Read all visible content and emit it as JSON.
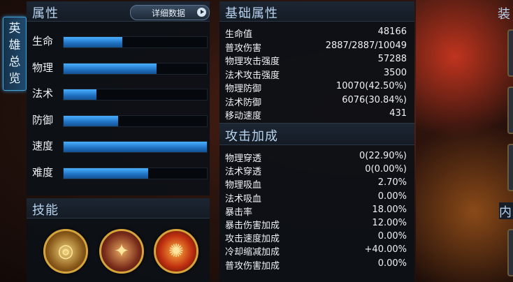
{
  "side_tab": {
    "label": "英雄总览"
  },
  "attributes": {
    "title": "属性",
    "detail_button": "详细数据",
    "bars": [
      {
        "label": "生命",
        "level": 0.41
      },
      {
        "label": "物理",
        "level": 0.65
      },
      {
        "label": "法术",
        "level": 0.23
      },
      {
        "label": "防御",
        "level": 0.38
      },
      {
        "label": "速度",
        "level": 1.0
      },
      {
        "label": "难度",
        "level": 0.59
      }
    ]
  },
  "skills": {
    "title": "技能",
    "icons": [
      "skill-1-icon",
      "skill-2-icon",
      "skill-3-icon"
    ]
  },
  "base_stats": {
    "title": "基础属性",
    "rows": [
      {
        "label": "生命值",
        "value": "48166"
      },
      {
        "label": "普攻伤害",
        "value": "2887/2887/10049"
      },
      {
        "label": "物理攻击强度",
        "value": "57288"
      },
      {
        "label": "法术攻击强度",
        "value": "3500"
      },
      {
        "label": "物理防御",
        "value": "10070(42.50%)"
      },
      {
        "label": "法术防御",
        "value": "6076(30.84%)"
      },
      {
        "label": "移动速度",
        "value": "431"
      }
    ]
  },
  "attack_bonus": {
    "title": "攻击加成",
    "rows": [
      {
        "label": "物理穿透",
        "value": "0(22.90%)"
      },
      {
        "label": "法术穿透",
        "value": "0(0.00%)"
      },
      {
        "label": "物理吸血",
        "value": "2.70%"
      },
      {
        "label": "法术吸血",
        "value": "0.00%"
      },
      {
        "label": "暴击率",
        "value": "18.00%"
      },
      {
        "label": "暴击伤害加成",
        "value": "12.00%"
      },
      {
        "label": "攻击速度加成",
        "value": "0.00%"
      },
      {
        "label": "冷却缩减加成",
        "value": "+40.00%"
      },
      {
        "label": "普攻伤害加成",
        "value": "0.00%"
      }
    ]
  },
  "right_edge": {
    "equip_title": "装",
    "inner_title": "内"
  },
  "colors": {
    "bar_fill": "#2f8fe6",
    "accent": "#4ba3d6",
    "skill_ring": "#d6a43a"
  }
}
